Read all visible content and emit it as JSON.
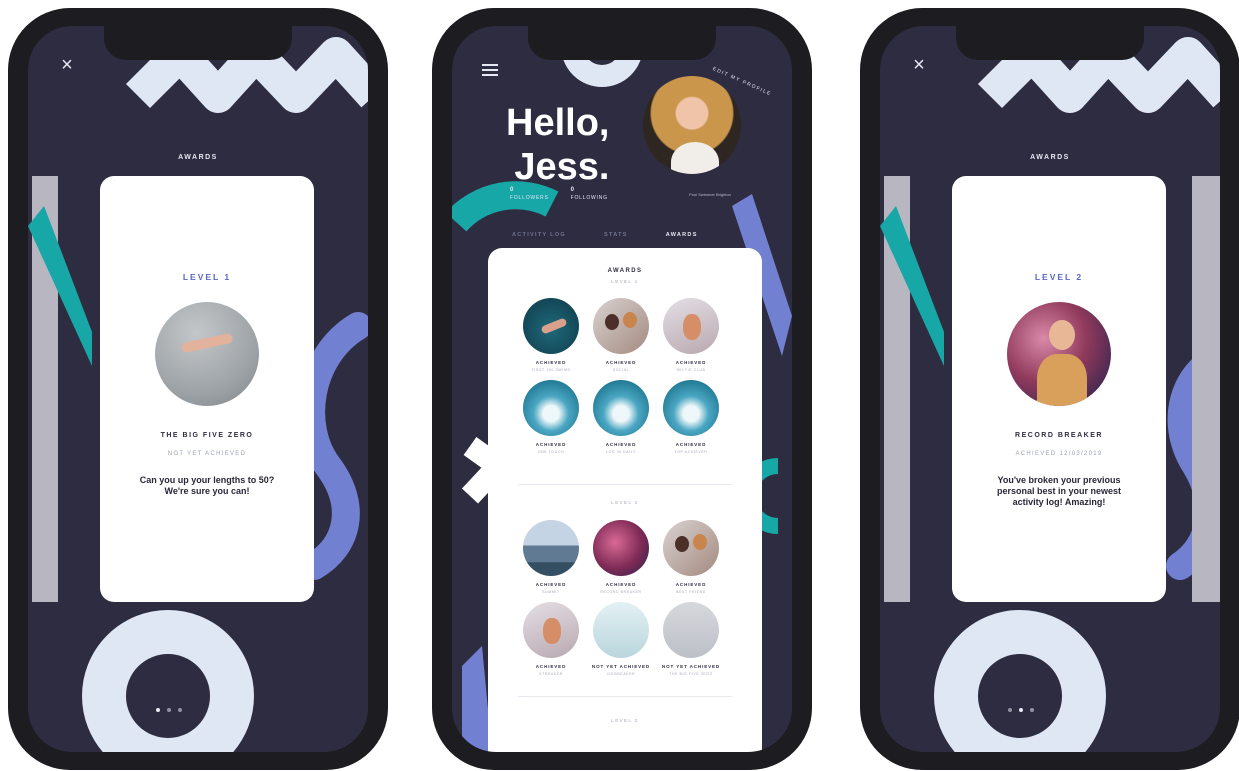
{
  "screens": [
    {
      "title": "AWARDS",
      "close_glyph": "×",
      "card": {
        "level": "LEVEL 1",
        "award_name": "THE BIG FIVE ZERO",
        "status": "NOT YET ACHIEVED",
        "description": "Can you up your lengths to 50? We're sure you can!"
      }
    },
    {
      "greeting_line1": "Hello,",
      "greeting_line2": "Jess.",
      "edit_profile": "EDIT MY PROFILE",
      "stats": [
        {
          "count": "0",
          "label": "FOLLOWERS"
        },
        {
          "count": "0",
          "label": "FOLLOWING"
        }
      ],
      "bio": "Pool Swimmer Brighton",
      "tabs": [
        "ACTIVITY LOG",
        "STATS",
        "AWARDS"
      ],
      "awards_title": "AWARDS",
      "sections": [
        "LEVEL 1",
        "LEVEL 2",
        "LEVEL 3"
      ],
      "level1": [
        {
          "name": "ACHIEVED",
          "caption": "FIRST 100 SWIMS"
        },
        {
          "name": "ACHIEVED",
          "caption": "SOCIAL"
        },
        {
          "name": "ACHIEVED",
          "caption": "SELFIE CLUB"
        },
        {
          "name": "ACHIEVED",
          "caption": "ONE TOUCH"
        },
        {
          "name": "ACHIEVED",
          "caption": "LOG IN DAILY"
        },
        {
          "name": "ACHIEVED",
          "caption": "TOP ACHIEVER"
        }
      ],
      "level2": [
        {
          "name": "ACHIEVED",
          "caption": "SUMMIT"
        },
        {
          "name": "ACHIEVED",
          "caption": "RECORD BREAKER"
        },
        {
          "name": "ACHIEVED",
          "caption": "BEST FRIEND"
        },
        {
          "name": "ACHIEVED",
          "caption": "STREAKER"
        },
        {
          "name": "NOT YET ACHIEVED",
          "caption": "ICEBREAKER"
        },
        {
          "name": "NOT YET ACHIEVED",
          "caption": "THE BIG FIVE ZERO"
        }
      ]
    },
    {
      "title": "AWARDS",
      "close_glyph": "×",
      "card": {
        "level": "LEVEL 2",
        "award_name": "RECORD BREAKER",
        "status": "ACHIEVED 12/03/2019",
        "description": "You've broken your previous personal best in your newest activity log! Amazing!"
      }
    }
  ],
  "colors": {
    "background": "#2e2c40",
    "light": "#dfe6f4",
    "teal": "#17a7a7",
    "periwinkle": "#7280d1",
    "accent_text": "#5767c4"
  },
  "icons": [
    "close-icon",
    "menu-icon"
  ]
}
